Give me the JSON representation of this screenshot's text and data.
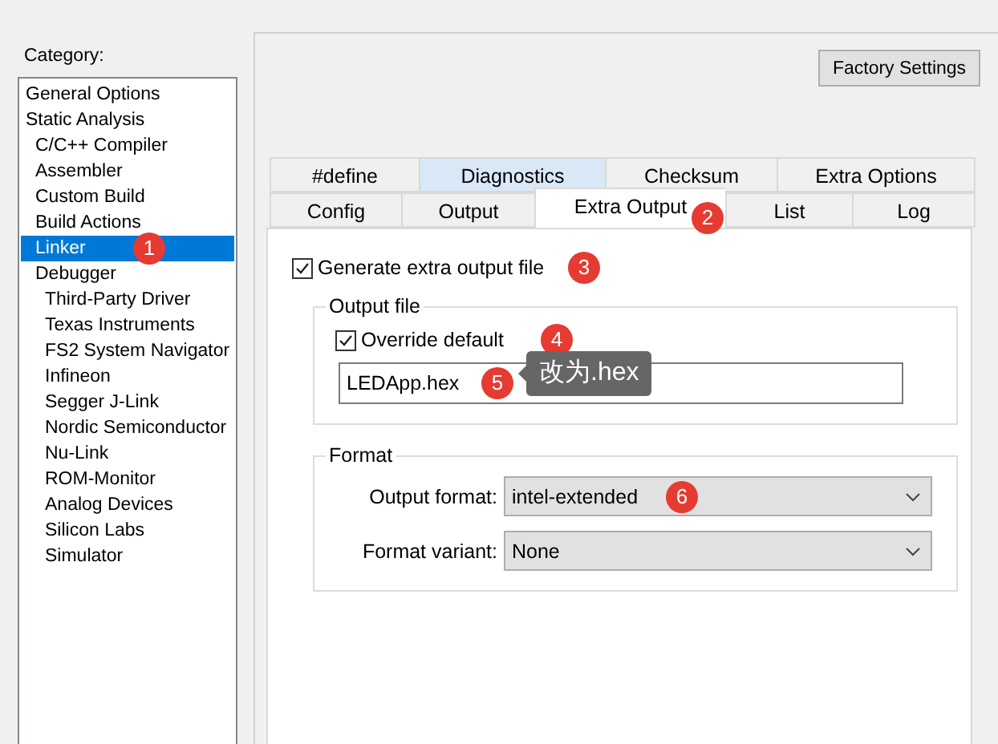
{
  "category_label": "Category:",
  "sidebar": {
    "items": [
      {
        "label": "General Options",
        "selected": false
      },
      {
        "label": "Static Analysis",
        "selected": false,
        "children": [
          {
            "label": "C/C++ Compiler",
            "selected": false
          },
          {
            "label": "Assembler",
            "selected": false
          },
          {
            "label": "Custom Build",
            "selected": false
          },
          {
            "label": "Build Actions",
            "selected": false
          },
          {
            "label": "Linker",
            "selected": true,
            "badge": "1"
          },
          {
            "label": "Debugger",
            "selected": false,
            "children": [
              {
                "label": "Third-Party Driver",
                "selected": false
              },
              {
                "label": "Texas Instruments",
                "selected": false
              },
              {
                "label": "FS2 System Navigator",
                "selected": false
              },
              {
                "label": "Infineon",
                "selected": false
              },
              {
                "label": "Segger J-Link",
                "selected": false
              },
              {
                "label": "Nordic Semiconductor",
                "selected": false
              },
              {
                "label": "Nu-Link",
                "selected": false
              },
              {
                "label": "ROM-Monitor",
                "selected": false
              },
              {
                "label": "Analog Devices",
                "selected": false
              },
              {
                "label": "Silicon Labs",
                "selected": false
              },
              {
                "label": "Simulator",
                "selected": false
              }
            ]
          }
        ]
      }
    ]
  },
  "factory_button": "Factory Settings",
  "tab_rows": [
    [
      {
        "label": "#define",
        "selected": false,
        "highlighted": false
      },
      {
        "label": "Diagnostics",
        "selected": false,
        "highlighted": true
      },
      {
        "label": "Checksum",
        "selected": false,
        "highlighted": false
      },
      {
        "label": "Extra Options",
        "selected": false,
        "highlighted": false
      }
    ],
    [
      {
        "label": "Config",
        "selected": false,
        "highlighted": false
      },
      {
        "label": "Output",
        "selected": false,
        "highlighted": false
      },
      {
        "label": "Extra Output",
        "selected": true,
        "highlighted": false,
        "badge": "2"
      },
      {
        "label": "List",
        "selected": false,
        "highlighted": false
      },
      {
        "label": "Log",
        "selected": false,
        "highlighted": false
      }
    ]
  ],
  "generate": {
    "label": "Generate extra output file",
    "checked": true,
    "badge": "3"
  },
  "output_file": {
    "title": "Output file",
    "override": {
      "label": "Override default",
      "checked": true,
      "badge": "4"
    },
    "value": "LEDApp.hex",
    "badge": "5",
    "note": "改为.hex"
  },
  "format": {
    "title": "Format",
    "fields": [
      {
        "label": "Output format:",
        "value": "intel-extended",
        "badge": "6"
      },
      {
        "label": "Format variant:",
        "value": "None"
      }
    ]
  }
}
